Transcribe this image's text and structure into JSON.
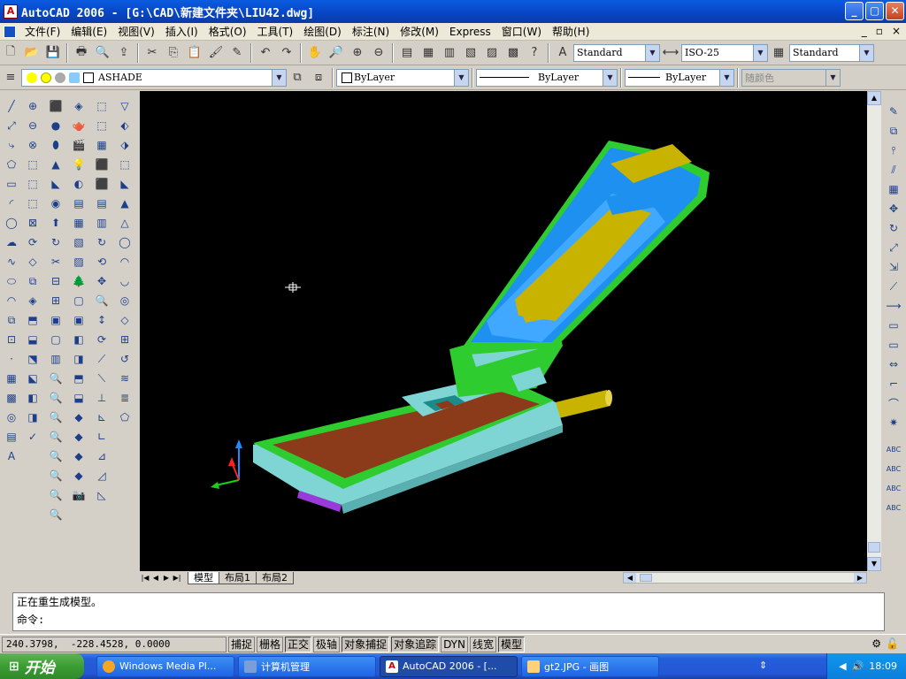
{
  "window": {
    "title": "AutoCAD 2006 - [G:\\CAD\\新建文件夹\\LIU42.dwg]",
    "btn_min": "_",
    "btn_max": "▢",
    "btn_close": "✕"
  },
  "menu": {
    "items": [
      "文件(F)",
      "编辑(E)",
      "视图(V)",
      "插入(I)",
      "格式(O)",
      "工具(T)",
      "绘图(D)",
      "标注(N)",
      "修改(M)",
      "Express",
      "窗口(W)",
      "帮助(H)"
    ],
    "mdi_min": "_",
    "mdi_restore": "▫",
    "mdi_close": "×"
  },
  "toolbar": {
    "text_style": "Standard",
    "dim_style": "ISO-25",
    "table_style": "Standard",
    "layer": "ASHADE",
    "color": "ByLayer",
    "linetype": "ByLayer",
    "lineweight": "ByLayer",
    "plot_style": "随颜色"
  },
  "tabs": {
    "model": "模型",
    "layout1": "布局1",
    "layout2": "布局2"
  },
  "command": {
    "line1": "正在重生成模型。",
    "line2": "命令:"
  },
  "status": {
    "coords": "240.3798,  -228.4528, 0.0000",
    "buttons": [
      {
        "label": "捕捉",
        "on": false
      },
      {
        "label": "栅格",
        "on": false
      },
      {
        "label": "正交",
        "on": true
      },
      {
        "label": "极轴",
        "on": false
      },
      {
        "label": "对象捕捉",
        "on": true
      },
      {
        "label": "对象追踪",
        "on": true
      },
      {
        "label": "DYN",
        "on": false
      },
      {
        "label": "线宽",
        "on": false
      },
      {
        "label": "模型",
        "on": true
      }
    ]
  },
  "taskbar": {
    "start": "开始",
    "tasks": [
      "Windows Media Pl...",
      "计算机管理",
      "AutoCAD 2006 - [...",
      "gt2.JPG - 画图"
    ],
    "clock": "18:09"
  },
  "colors": {
    "viewport_bg": "#000000",
    "titlebar": "#0a5ce0",
    "phone_green": "#2ecc2e",
    "phone_blue": "#1e90f0",
    "phone_yellow": "#c8b400",
    "phone_brown": "#8b3a1a",
    "phone_cyan": "#7fd4d4"
  }
}
